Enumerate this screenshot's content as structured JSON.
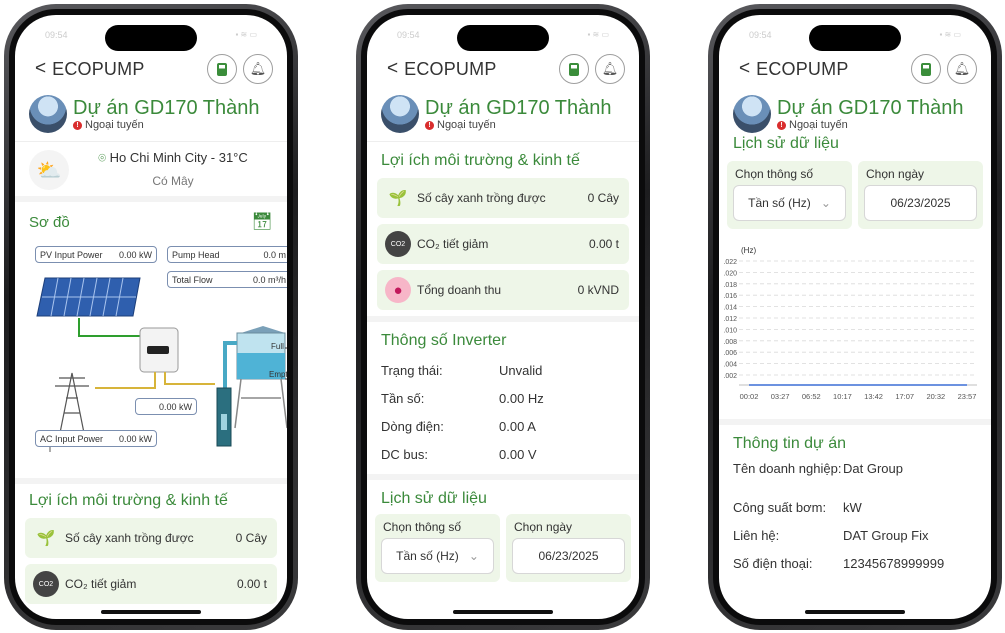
{
  "app": {
    "brand": "ECOPUMP",
    "back": "<",
    "time": "09:54"
  },
  "project": {
    "title": "Dự án GD170 Thành",
    "status": "Ngoại tuyến",
    "status_icon": "!"
  },
  "weather": {
    "city": "Ho Chi Minh City",
    "temp": " - 31°C",
    "desc": "Có Mây"
  },
  "diagram": {
    "title": "Sơ đồ",
    "pv_label": "PV Input Power",
    "pv_value": "0.00",
    "pv_unit": "kW",
    "head_label": "Pump Head",
    "head_value": "0.0",
    "head_unit": "m",
    "flow_label": "Total Flow",
    "flow_value": "0.0",
    "flow_unit": "m³/h",
    "inv_value": "0.00",
    "inv_unit": "kW",
    "ac_label": "AC Input Power",
    "ac_value": "0.00",
    "ac_unit": "kW",
    "full": "Full",
    "empty": "Empty"
  },
  "benefits": {
    "title": "Lợi ích môi trường & kinh tế",
    "items": [
      {
        "label": "Số cây xanh trồng được",
        "value": "0 Cây",
        "icon": "seedling-icon"
      },
      {
        "label": "CO₂ tiết giảm",
        "value": "0.00 t",
        "icon": "co2-icon"
      },
      {
        "label": "Tổng doanh thu",
        "value": "0 kVND",
        "icon": "piggy-bank-icon"
      }
    ]
  },
  "inverter": {
    "title": "Thông số Inverter",
    "rows": [
      {
        "k": "Trạng thái:",
        "v": "Unvalid"
      },
      {
        "k": "Tần số:",
        "v": "0.00 Hz"
      },
      {
        "k": "Dòng điện:",
        "v": "0.00 A"
      },
      {
        "k": "DC bus:",
        "v": "0.00 V"
      }
    ]
  },
  "history": {
    "title": "Lịch sử dữ liệu",
    "param_label": "Chọn thông số",
    "param_value": "Tần số (Hz)",
    "date_label": "Chọn ngày",
    "date_value": "06/23/2025",
    "chevron": "⌄"
  },
  "chart_data": {
    "type": "line",
    "ylabel": "(Hz)",
    "ytick_labels": [
      ".022",
      ".020",
      ".018",
      ".016",
      ".014",
      ".012",
      ".010",
      ".008",
      ".006",
      ".004",
      ".002"
    ],
    "x": [
      "00:02",
      "03:27",
      "06:52",
      "10:17",
      "13:42",
      "17:07",
      "20:32",
      "23:57"
    ],
    "series": [
      {
        "values": [
          0,
          0,
          0,
          0,
          0,
          0,
          0,
          0
        ]
      }
    ],
    "grid": true
  },
  "project_info": {
    "title": "Thông tin dự án",
    "rows": [
      {
        "k": "Tên doanh nghiệp:",
        "v": "Dat Group"
      },
      {
        "k": "Công suất bơm:",
        "v": "kW"
      },
      {
        "k": "Liên hệ:",
        "v": "DAT Group Fix"
      },
      {
        "k": "Số điện thoại:",
        "v": "12345678999999"
      }
    ]
  },
  "colors": {
    "accent": "#3b8a3b",
    "card_bg": "#eef6e8",
    "offline": "#d92d2d"
  }
}
